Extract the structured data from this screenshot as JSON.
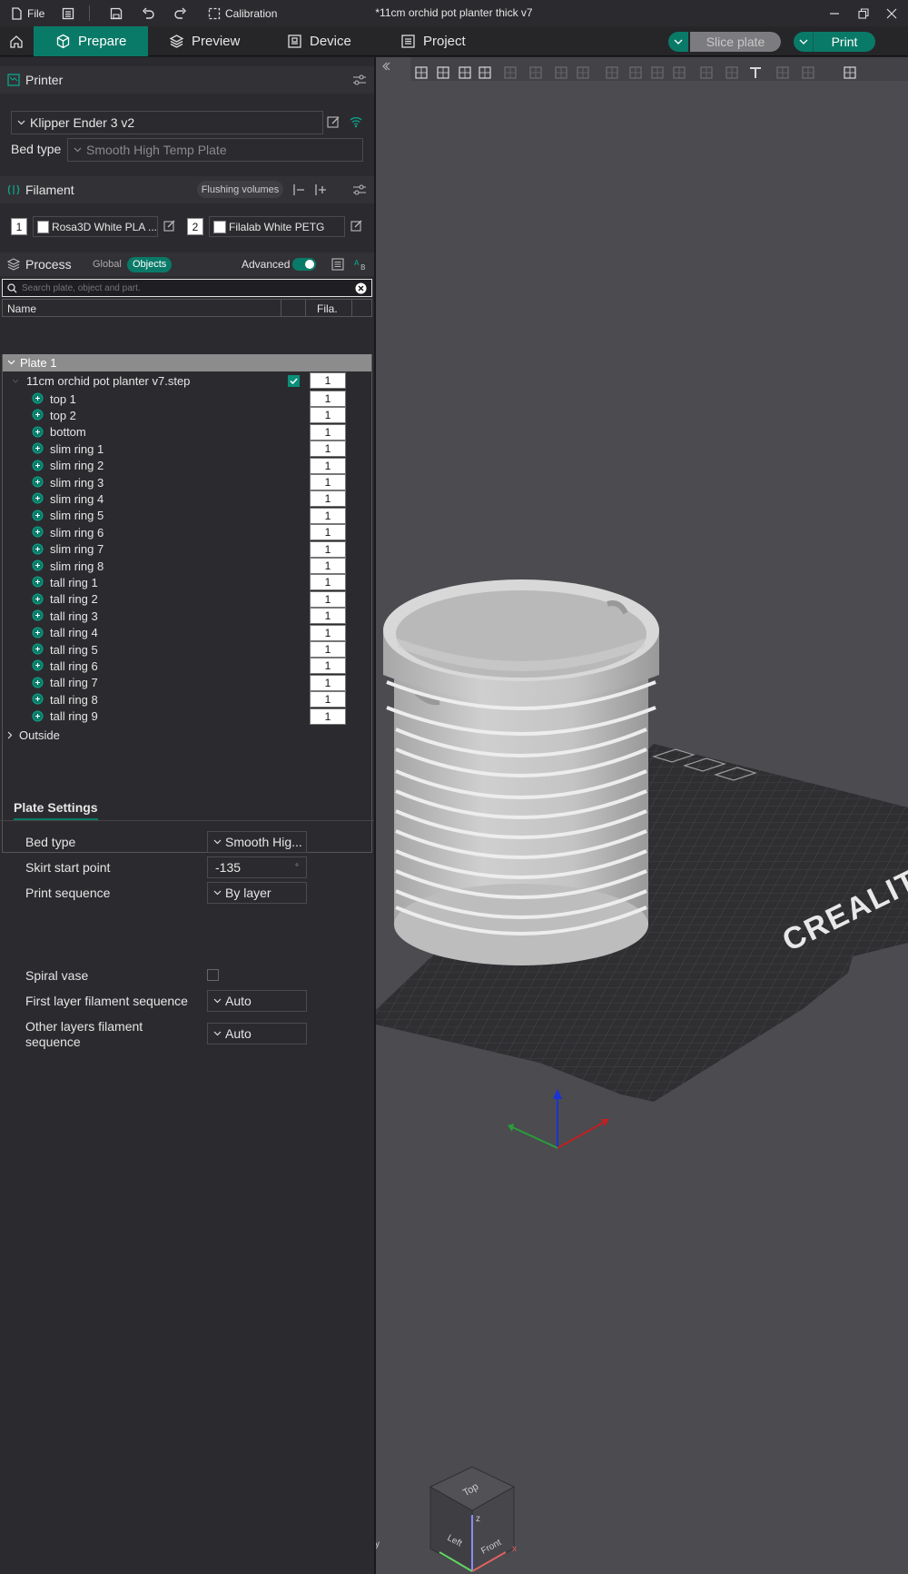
{
  "menu": {
    "file": "File",
    "calibration": "Calibration"
  },
  "window_title": "*11cm orchid pot planter thick v7",
  "tabs": {
    "prepare": "Prepare",
    "preview": "Preview",
    "device": "Device",
    "project": "Project"
  },
  "actions": {
    "slice": "Slice plate",
    "print": "Print"
  },
  "printer": {
    "section": "Printer",
    "name": "Klipper Ender 3 v2",
    "bed_label": "Bed type",
    "bed_value": "Smooth High Temp Plate"
  },
  "filament": {
    "section": "Filament",
    "flushing": "Flushing volumes",
    "slots": [
      {
        "num": "1",
        "name": "Rosa3D White PLA ...",
        "color": "#ffffff"
      },
      {
        "num": "2",
        "name": "Filalab White PETG",
        "color": "#ffffff"
      }
    ]
  },
  "process": {
    "section": "Process",
    "global": "Global",
    "objects": "Objects",
    "advanced": "Advanced",
    "search_placeholder": "Search plate, object and part."
  },
  "object_list": {
    "col_name": "Name",
    "col_fila": "Fila.",
    "plate": "Plate 1",
    "object": "11cm orchid pot planter v7.step",
    "object_fila": "1",
    "parts": [
      "top 1",
      "top 2",
      "bottom",
      "slim ring 1",
      "slim ring 2",
      "slim ring 3",
      "slim ring 4",
      "slim ring 5",
      "slim ring 6",
      "slim ring 7",
      "slim ring 8",
      "tall ring 1",
      "tall ring 2",
      "tall ring 3",
      "tall ring 4",
      "tall ring 5",
      "tall ring 6",
      "tall ring 7",
      "tall ring 8",
      "tall ring 9"
    ],
    "part_fila": "1",
    "outside": "Outside"
  },
  "plate_settings": {
    "title": "Plate Settings",
    "bed_type_label": "Bed type",
    "bed_type_value": "Smooth Hig...",
    "skirt_label": "Skirt start point",
    "skirt_value": "-135",
    "skirt_unit": "°",
    "sequence_label": "Print sequence",
    "sequence_value": "By layer",
    "spiral_label": "Spiral vase",
    "spiral_checked": false,
    "first_layer_label": "First layer filament sequence",
    "first_layer_value": "Auto",
    "other_layers_label_1": "Other layers filament",
    "other_layers_label_2": "sequence",
    "other_layers_value": "Auto"
  },
  "viewport": {
    "bed_brand": "CREALITY",
    "cube_top": "Top",
    "cube_left": "Left",
    "cube_front": "Front",
    "axis_x": "x",
    "axis_y": "y",
    "axis_z": "z"
  },
  "colors": {
    "accent": "#0a7a68",
    "panel": "#2b2b2f",
    "viewport": "#4b4b50",
    "bed": "#2f2f32"
  }
}
